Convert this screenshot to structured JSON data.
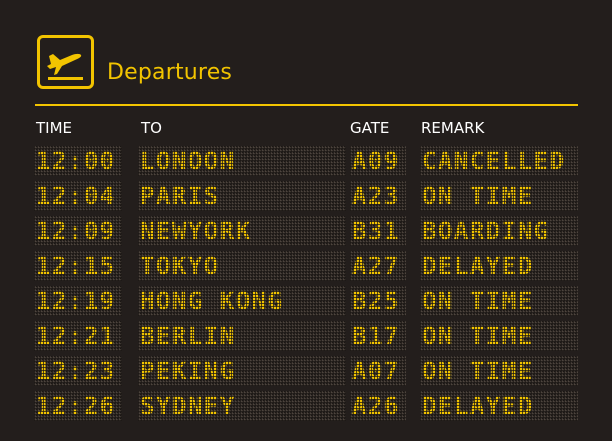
{
  "board": {
    "title": "Departures",
    "accent_color": "#f2c400",
    "background_color": "#231e1c",
    "icon": "plane-takeoff-icon",
    "headers": {
      "time": "TIME",
      "to": "TO",
      "gate": "GATE",
      "remark": "REMARK"
    },
    "flights": [
      {
        "time": "12:00",
        "to": "LONOON",
        "gate": "A09",
        "remark": "CANCELLED"
      },
      {
        "time": "12:04",
        "to": "PARIS",
        "gate": "A23",
        "remark": "ON TIME"
      },
      {
        "time": "12:09",
        "to": "NEWYORK",
        "gate": "B31",
        "remark": "BOARDING"
      },
      {
        "time": "12:15",
        "to": "TOKYO",
        "gate": "A27",
        "remark": "DELAYED"
      },
      {
        "time": "12:19",
        "to": "HONG KONG",
        "gate": "B25",
        "remark": "ON TIME"
      },
      {
        "time": "12:21",
        "to": "BERLIN",
        "gate": "B17",
        "remark": "ON TIME"
      },
      {
        "time": "12:23",
        "to": "PEKING",
        "gate": "A07",
        "remark": "ON TIME"
      },
      {
        "time": "12:26",
        "to": "SYDNEY",
        "gate": "A26",
        "remark": "DELAYED"
      }
    ]
  }
}
